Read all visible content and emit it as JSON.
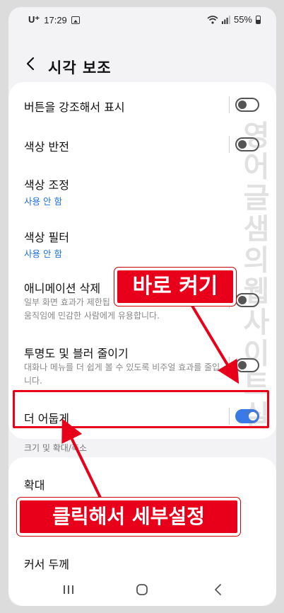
{
  "status": {
    "carrier": "U⁺",
    "time": "17:29",
    "battery": "55%"
  },
  "header": {
    "title": "시각 보조"
  },
  "settings": {
    "highlight_buttons": {
      "label": "버튼을 강조해서 표시",
      "on": false
    },
    "color_inversion": {
      "label": "색상 반전",
      "on": false
    },
    "color_adjustment": {
      "label": "색상 조정",
      "value": "사용 안 함"
    },
    "color_filter": {
      "label": "색상 필터",
      "value": "사용 안 함"
    },
    "remove_animations": {
      "label": "애니메이션 삭제",
      "desc_line1": "일부 화면 효과가 제한됩",
      "desc_line2": "움직임에 민감한 사람에게 유용합니다.",
      "on": false
    },
    "reduce_transparency": {
      "label": "투명도 및 블러 줄이기",
      "desc": "대화나 메뉴를 더 쉽게 볼 수 있도록 비주얼 효과를 줄입니다.",
      "on": false
    },
    "extra_dim": {
      "label": "더 어둡게",
      "on": true
    }
  },
  "section2": {
    "label": "크기 및 확대/축소",
    "magnification": "확대",
    "cursor_thickness": "커서 두께"
  },
  "annotations": {
    "top_callout": "바로 켜기",
    "bottom_callout": "클릭해서 세부설정",
    "watermark": [
      "영",
      "어",
      "글",
      "샘",
      "의",
      "웹",
      "사",
      "이",
      "트",
      "실"
    ],
    "color": "#e8001a"
  },
  "icons": {
    "back": "chevron-left-icon",
    "recents": "recents-icon",
    "home": "home-icon",
    "nav_back": "back-icon"
  }
}
